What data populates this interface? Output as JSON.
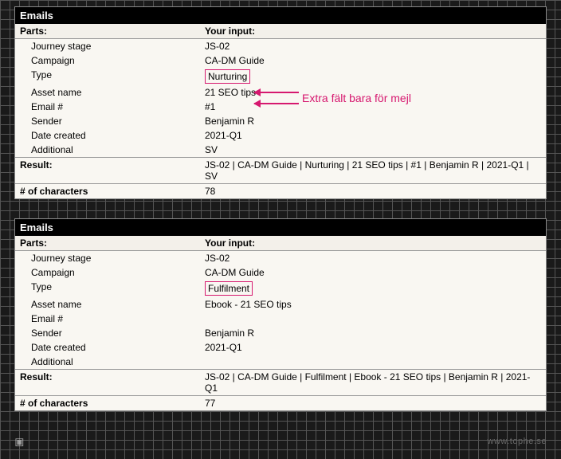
{
  "annotation": "Extra fält bara för mejl",
  "footer": {
    "text": "www.tophe.se"
  },
  "tables": [
    {
      "title": "Emails",
      "header": {
        "col1": "Parts:",
        "col2": "Your input:"
      },
      "rows": [
        {
          "label": "Journey stage",
          "value": "JS-02"
        },
        {
          "label": "Campaign",
          "value": "CA-DM Guide"
        },
        {
          "label": "Type",
          "value": "Nurturing",
          "boxed": true
        },
        {
          "label": "Asset name",
          "value": "21 SEO tips"
        },
        {
          "label": "Email #",
          "value": "#1"
        },
        {
          "label": "Sender",
          "value": "Benjamin R"
        },
        {
          "label": "Date created",
          "value": "2021-Q1"
        },
        {
          "label": "Additional",
          "value": "SV"
        }
      ],
      "result": {
        "label": "Result:",
        "value": "JS-02 | CA-DM Guide | Nurturing | 21 SEO tips | #1 | Benjamin R | 2021-Q1 | SV"
      },
      "chars": {
        "label": "# of characters",
        "value": "78"
      },
      "annotated": true
    },
    {
      "title": "Emails",
      "header": {
        "col1": "Parts:",
        "col2": "Your input:"
      },
      "rows": [
        {
          "label": "Journey stage",
          "value": "JS-02"
        },
        {
          "label": "Campaign",
          "value": "CA-DM Guide"
        },
        {
          "label": "Type",
          "value": "Fulfilment",
          "boxed": true
        },
        {
          "label": "Asset name",
          "value": "Ebook - 21 SEO tips"
        },
        {
          "label": "Email #",
          "value": ""
        },
        {
          "label": "Sender",
          "value": "Benjamin R"
        },
        {
          "label": "Date created",
          "value": "2021-Q1"
        },
        {
          "label": "Additional",
          "value": ""
        }
      ],
      "result": {
        "label": "Result:",
        "value": "JS-02 | CA-DM Guide | Fulfilment | Ebook - 21 SEO tips | Benjamin R | 2021-Q1"
      },
      "chars": {
        "label": "# of characters",
        "value": "77"
      },
      "annotated": false
    }
  ]
}
